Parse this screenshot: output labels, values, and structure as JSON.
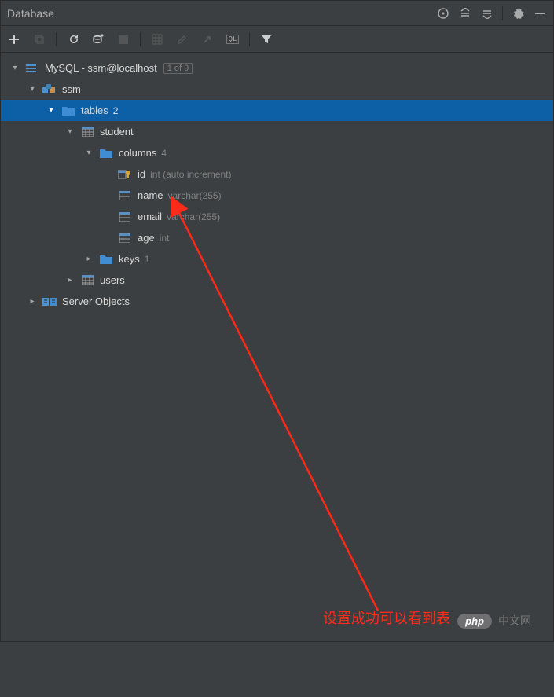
{
  "titlebar": {
    "title": "Database"
  },
  "toolbar": {
    "ql_label": "QL"
  },
  "tree": {
    "datasource": {
      "label": "MySQL - ssm@localhost",
      "badge": "1 of 9"
    },
    "schema": {
      "label": "ssm"
    },
    "tables_folder": {
      "label": "tables",
      "count": "2"
    },
    "student": {
      "label": "student"
    },
    "columns_folder": {
      "label": "columns",
      "count": "4"
    },
    "col_id": {
      "name": "id",
      "type": "int (auto increment)"
    },
    "col_name": {
      "name": "name",
      "type": "varchar(255)"
    },
    "col_email": {
      "name": "email",
      "type": "varchar(255)"
    },
    "col_age": {
      "name": "age",
      "type": "int"
    },
    "keys_folder": {
      "label": "keys",
      "count": "1"
    },
    "users": {
      "label": "users"
    },
    "server_objects": {
      "label": "Server Objects"
    }
  },
  "annotation": "设置成功可以看到表",
  "watermark": {
    "badge": "php",
    "text": "中文网"
  }
}
